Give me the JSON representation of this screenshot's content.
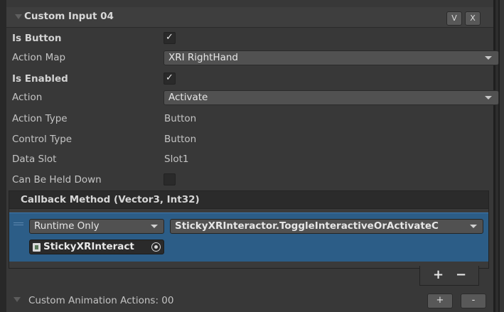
{
  "header": {
    "title": "Custom Input 04",
    "v_label": "V",
    "x_label": "X"
  },
  "fields": {
    "is_button": {
      "label": "Is Button",
      "checked": true
    },
    "action_map": {
      "label": "Action Map",
      "value": "XRI RightHand"
    },
    "is_enabled": {
      "label": "Is Enabled",
      "checked": true
    },
    "action": {
      "label": "Action",
      "value": "Activate"
    },
    "action_type": {
      "label": "Action Type",
      "value": "Button"
    },
    "control_type": {
      "label": "Control Type",
      "value": "Button"
    },
    "data_slot": {
      "label": "Data Slot",
      "value": "Slot1"
    },
    "can_be_held_down": {
      "label": "Can Be Held Down",
      "checked": false
    }
  },
  "check_glyph": "✓",
  "callback": {
    "title": "Callback Method (Vector3, Int32)",
    "runtime_mode": "Runtime Only",
    "method": "StickyXRInteractor.ToggleInteractiveOrActivateC",
    "object": "StickyXRInteract",
    "plus_label": "+",
    "minus_label": "−"
  },
  "animations": {
    "label": "Custom Animation Actions: 00",
    "add_label": "+",
    "remove_label": "-"
  }
}
